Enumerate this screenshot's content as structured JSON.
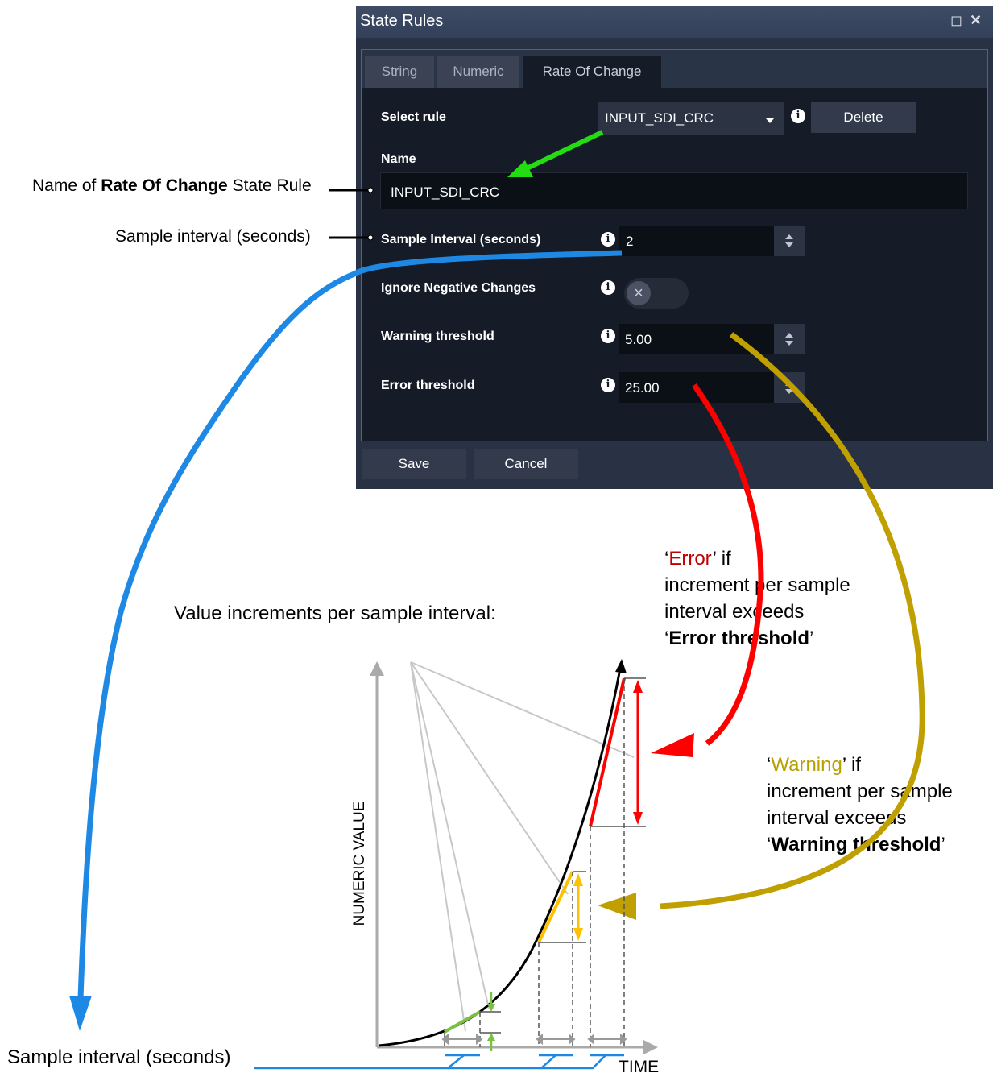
{
  "dialog": {
    "title": "State Rules",
    "tabs": [
      {
        "label": "String",
        "active": false
      },
      {
        "label": "Numeric",
        "active": false
      },
      {
        "label": "Rate Of Change",
        "active": true
      }
    ],
    "select_rule_label": "Select rule",
    "select_rule_value": "INPUT_SDI_CRC",
    "delete_label": "Delete",
    "name_label": "Name",
    "name_value": "INPUT_SDI_CRC",
    "sample_interval_label": "Sample Interval (seconds)",
    "sample_interval_value": "2",
    "ignore_negative_label": "Ignore Negative Changes",
    "ignore_negative_on": false,
    "warning_label": "Warning threshold",
    "warning_value": "5.00",
    "error_label": "Error threshold",
    "error_value": "25.00",
    "save_label": "Save",
    "cancel_label": "Cancel"
  },
  "annotations": {
    "name_prefix": "Name of ",
    "name_bold": "Rate Of Change",
    "name_suffix": " State Rule",
    "sample_interval_top": "Sample interval (seconds)",
    "sample_interval_bottom": "Sample interval (seconds)",
    "value_increments": "Value increments per sample interval:",
    "error_word": "Error",
    "error_if": " if",
    "error_line2": "increment per sample",
    "error_line3": "interval exceeds",
    "error_threshold_bold": "Error threshold",
    "warning_word": "Warning",
    "warning_if": " if",
    "warning_line2": "increment per sample",
    "warning_line3": "interval exceeds",
    "warning_threshold_bold": "Warning threshold"
  },
  "graph": {
    "y_axis_label": "NUMERIC VALUE",
    "x_axis_label": "TIME"
  },
  "colors": {
    "error": "#ff0000",
    "warning": "#ffc000",
    "ok": "#7ac143",
    "interval": "#1e88e5",
    "warning_arrow": "#c0a000"
  }
}
